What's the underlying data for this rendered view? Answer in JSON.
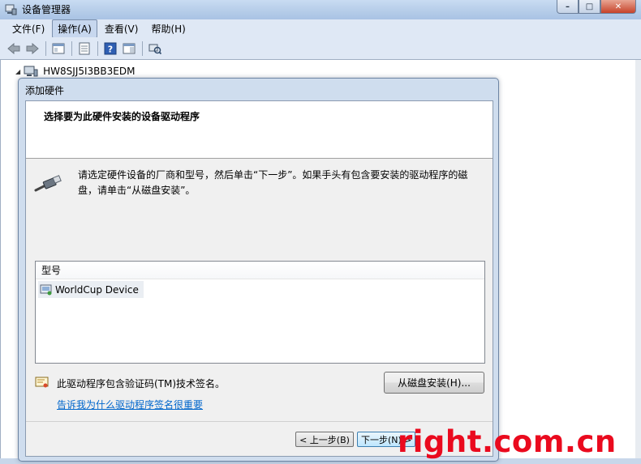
{
  "window": {
    "title": "设备管理器",
    "icon": "device-manager-icon",
    "minimize": "–",
    "maximize": "□",
    "close": "✕"
  },
  "menu": {
    "items": [
      "文件(F)",
      "操作(A)",
      "查看(V)",
      "帮助(H)"
    ],
    "active_index": 1
  },
  "toolbar": {
    "icons": [
      "back-arrow-icon",
      "forward-arrow-icon",
      "show-hide-tree-icon",
      "properties-icon",
      "help-icon",
      "action-pane-icon",
      "scan-hardware-icon"
    ]
  },
  "tree": {
    "root_label": "HW8SJJ5I3BB3EDM"
  },
  "dialog": {
    "title": "添加硬件",
    "heading": "选择要为此硬件安装的设备驱动程序",
    "instructions": "请选定硬件设备的厂商和型号，然后单击“下一步”。如果手头有包含要安装的驱动程序的磁盘，请单击“从磁盘安装”。",
    "list_header": "型号",
    "list_items": [
      "WorldCup Device"
    ],
    "signature_text": "此驱动程序包含验证码(TM)技术签名。",
    "signature_link": "告诉我为什么驱动程序签名很重要",
    "disk_button": "从磁盘安装(H)...",
    "prev_button": "< 上一步(B)",
    "next_button": "下一步(N) >"
  },
  "watermark": "right.com.cn",
  "colors": {
    "titlebar": "#b6cde9",
    "link": "#0066cc",
    "watermark": "#ea0a1e"
  }
}
